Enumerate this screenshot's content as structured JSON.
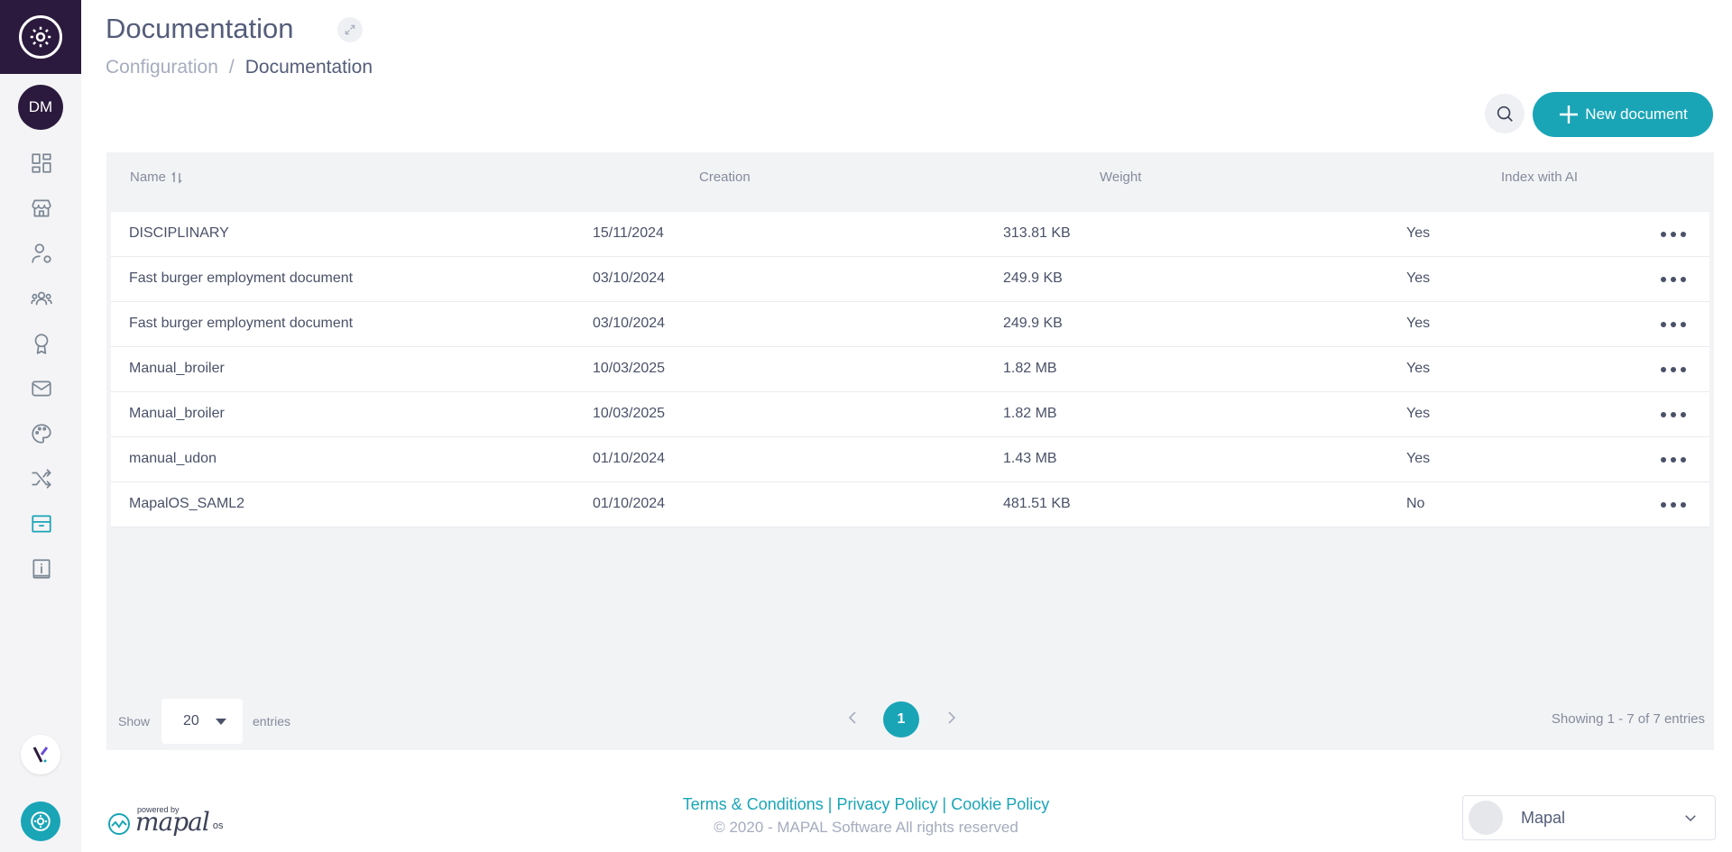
{
  "header": {
    "title": "Documentation",
    "breadcrumb": [
      "Configuration",
      "/",
      "Documentation"
    ]
  },
  "user": {
    "initials": "DM"
  },
  "sidebar": {
    "items": [
      {
        "name": "dashboard",
        "icon": "grid-icon"
      },
      {
        "name": "stores",
        "icon": "store-icon"
      },
      {
        "name": "user-settings",
        "icon": "user-gear-icon"
      },
      {
        "name": "teams",
        "icon": "users-icon"
      },
      {
        "name": "awards",
        "icon": "badge-icon"
      },
      {
        "name": "messages",
        "icon": "mail-icon"
      },
      {
        "name": "appearance",
        "icon": "palette-icon"
      },
      {
        "name": "integrations",
        "icon": "shuffle-icon"
      },
      {
        "name": "documentation",
        "icon": "archive-icon",
        "active": true
      },
      {
        "name": "info",
        "icon": "info-book-icon"
      }
    ]
  },
  "toolbar": {
    "new_document_label": "New document"
  },
  "table": {
    "columns": [
      "Name",
      "Creation",
      "Weight",
      "Index with AI"
    ],
    "rows": [
      {
        "name": "DISCIPLINARY",
        "creation": "15/11/2024",
        "weight": "313.81 KB",
        "index_ai": "Yes"
      },
      {
        "name": "Fast burger employment document",
        "creation": "03/10/2024",
        "weight": "249.9 KB",
        "index_ai": "Yes"
      },
      {
        "name": "Fast burger employment document",
        "creation": "03/10/2024",
        "weight": "249.9 KB",
        "index_ai": "Yes"
      },
      {
        "name": "Manual_broiler",
        "creation": "10/03/2025",
        "weight": "1.82 MB",
        "index_ai": "Yes"
      },
      {
        "name": "Manual_broiler",
        "creation": "10/03/2025",
        "weight": "1.82 MB",
        "index_ai": "Yes"
      },
      {
        "name": "manual_udon",
        "creation": "01/10/2024",
        "weight": "1.43 MB",
        "index_ai": "Yes"
      },
      {
        "name": "MapalOS_SAML2",
        "creation": "01/10/2024",
        "weight": "481.51 KB",
        "index_ai": "No"
      }
    ]
  },
  "pagination": {
    "show_label": "Show",
    "page_size": "20",
    "entries_label": "entries",
    "current_page": "1",
    "summary": "Showing 1 - 7 of 7 entries"
  },
  "footer": {
    "powered_by": "powered by",
    "brand": "mapal",
    "brand_suffix": "os",
    "links": [
      "Terms & Conditions",
      "Privacy Policy",
      "Cookie Policy"
    ],
    "link_separator": "|",
    "copyright": "© 2020 - MAPAL Software All rights reserved",
    "org_name": "Mapal"
  },
  "colors": {
    "accent": "#1aa5b7",
    "sidebar_brand": "#2b1a3d"
  }
}
